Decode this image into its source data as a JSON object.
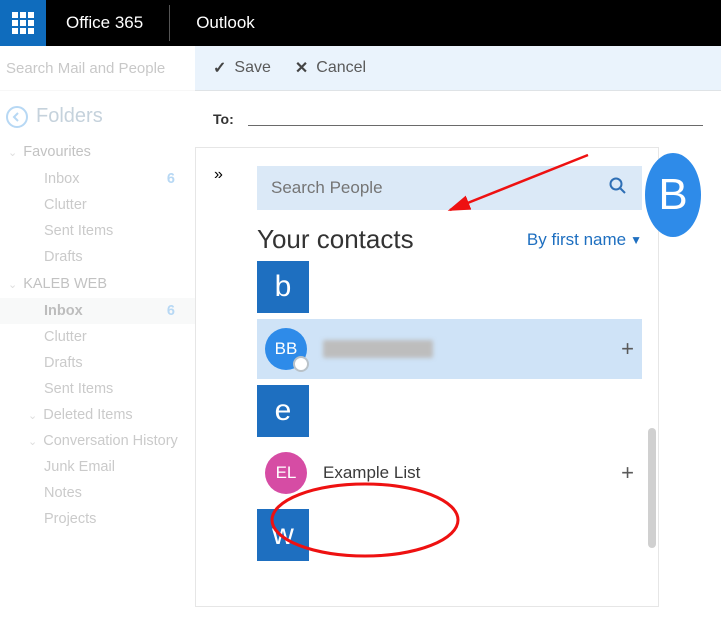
{
  "header": {
    "brand": "Office 365",
    "app": "Outlook"
  },
  "search": {
    "placeholder": "Search Mail and People"
  },
  "folders": {
    "title": "Folders",
    "groups": [
      {
        "name": "Favourites",
        "items": [
          {
            "label": "Inbox",
            "badge": "6"
          },
          {
            "label": "Clutter"
          },
          {
            "label": "Sent Items"
          },
          {
            "label": "Drafts"
          }
        ]
      },
      {
        "name": "KALEB WEB",
        "items": [
          {
            "label": "Inbox",
            "badge": "6",
            "selected": true
          },
          {
            "label": "Clutter"
          },
          {
            "label": "Drafts"
          },
          {
            "label": "Sent Items"
          },
          {
            "label": "Deleted Items",
            "expandable": true
          },
          {
            "label": "Conversation History",
            "expandable": true
          },
          {
            "label": "Junk Email"
          },
          {
            "label": "Notes"
          },
          {
            "label": "Projects"
          }
        ]
      }
    ]
  },
  "toolbar": {
    "save": "Save",
    "cancel": "Cancel"
  },
  "compose": {
    "to_label": "To:"
  },
  "people": {
    "search_placeholder": "Search People",
    "title": "Your contacts",
    "sort": "By first name",
    "big_avatar_initial": "B",
    "sections": {
      "b": {
        "letter": "b",
        "contacts": [
          {
            "initials": "BB",
            "name": "",
            "redacted": true,
            "avatar_color": "blue",
            "selected": true
          }
        ]
      },
      "e": {
        "letter": "e",
        "contacts": [
          {
            "initials": "EL",
            "name": "Example List",
            "avatar_color": "pink"
          }
        ]
      },
      "w": {
        "letter": "w",
        "contacts": []
      }
    }
  }
}
